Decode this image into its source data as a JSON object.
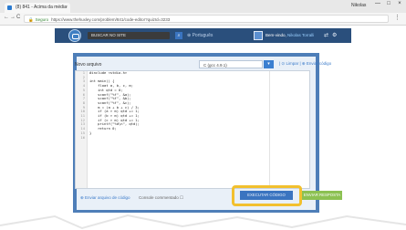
{
  "browser": {
    "tab_title": "(8) 841 - Acima da média",
    "tab_close": "×",
    "user": "Nikolas",
    "win_min": "—",
    "win_max": "□",
    "win_close": "×",
    "back": "←",
    "forward": "→",
    "reload": "C",
    "lock": "🔒",
    "secure_label": "Seguro",
    "url": "https://www.thehuxley.com/problem/841/code-editor?quizId=3233",
    "menu": "⋮"
  },
  "site_header": {
    "search_placeholder": "BUSCAR NO SITE",
    "search_icon": "⌕",
    "language": "⊕ Português",
    "welcome_text": "Bem-vindo,",
    "user_name": "Nikolas Torralli",
    "icon_share": "⇄",
    "icon_settings": "⚙"
  },
  "editor_area": {
    "new_label": "Novo arquivo",
    "language_select": "C (gcc 4.9.1)",
    "dropdown_arrow": "▾",
    "clear_link": "| ⊙ Limpar | ⊕ Enviar código",
    "code_lines": [
      "#include <stdio.h>",
      "",
      "int main() {",
      "    float a, b, c, m;",
      "    int qtd = 0;",
      "    scanf(\"%f\", &a);",
      "    scanf(\"%f\", &b);",
      "    scanf(\"%f\", &c);",
      "    m = (a + b + c) / 3;",
      "    if (a > m) qtd += 1;",
      "    if (b > m) qtd += 1;",
      "    if (c > m) qtd += 1;",
      "    printf(\"%d\\n\", qtd);",
      "    return 0;",
      "}",
      ""
    ],
    "line_numbers": [
      "1",
      "2",
      "3",
      "4",
      "5",
      "6",
      "7",
      "8",
      "9",
      "10",
      "11",
      "12",
      "13",
      "14",
      "15",
      "16"
    ]
  },
  "footer": {
    "upload_link": "⊕ Enviar arquivo de código",
    "commit_label": "Console commentado ☐",
    "execute_button": "EXECUTAR CÓDIGO",
    "submit_button": "ENVIAR RESPOSTA"
  },
  "colors": {
    "header_blue": "#2a4f7c",
    "panel_blue": "#4e7eb8",
    "highlight": "#f2c02e",
    "execute_btn": "#3a74c0",
    "submit_btn": "#8cc152"
  }
}
